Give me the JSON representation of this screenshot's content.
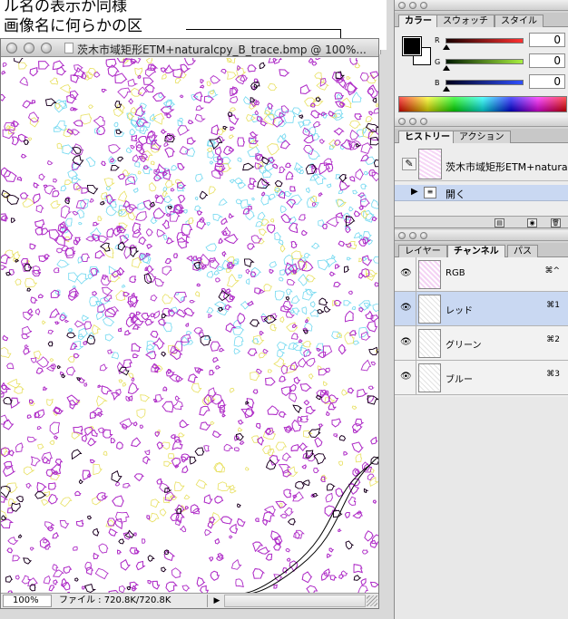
{
  "background_document": {
    "lines": [
      "ル名の表示か同様",
      "画像名に何らかの区",
      "。"
    ]
  },
  "image_window": {
    "title": "茨木市域矩形ETM+naturalcpy_B_trace.bmp @ 100%...",
    "zoom": "100%",
    "file_info": "ファイル : 720.8K/720.8K",
    "status_arrow": "▶"
  },
  "color_panel": {
    "tabs": [
      "カラー",
      "スウォッチ",
      "スタイル"
    ],
    "active_tab": "カラー",
    "channels": [
      {
        "label": "R",
        "value": "0",
        "color_start": "#1a0000",
        "color_end": "#ff3030"
      },
      {
        "label": "G",
        "value": "0",
        "color_start": "#001a00",
        "color_end": "#a8f040"
      },
      {
        "label": "B",
        "value": "0",
        "color_start": "#00001a",
        "color_end": "#3050ff"
      }
    ],
    "foreground_color": "#000000",
    "background_color": "#ffffff"
  },
  "history_panel": {
    "tabs": [
      "ヒストリー",
      "アクション"
    ],
    "active_tab": "ヒストリー",
    "snapshot_label": "茨木市域矩形ETM+naturalc...",
    "steps": [
      {
        "label": "開く",
        "icon": "document-icon"
      }
    ]
  },
  "channels_panel": {
    "tabs": [
      "レイヤー",
      "チャンネル",
      "パス"
    ],
    "active_tab": "チャンネル",
    "rows": [
      {
        "name": "RGB",
        "shortcut": "⌘^",
        "selected": false,
        "thumb": "rgb"
      },
      {
        "name": "レッド",
        "shortcut": "⌘1",
        "selected": true,
        "thumb": "gray"
      },
      {
        "name": "グリーン",
        "shortcut": "⌘2",
        "selected": false,
        "thumb": "gray"
      },
      {
        "name": "ブルー",
        "shortcut": "⌘3",
        "selected": false,
        "thumb": "gray"
      }
    ]
  },
  "trace_colors": {
    "magenta": "#b030c8",
    "yellow": "#e8e060",
    "cyan": "#70d8f0",
    "black": "#000000"
  }
}
